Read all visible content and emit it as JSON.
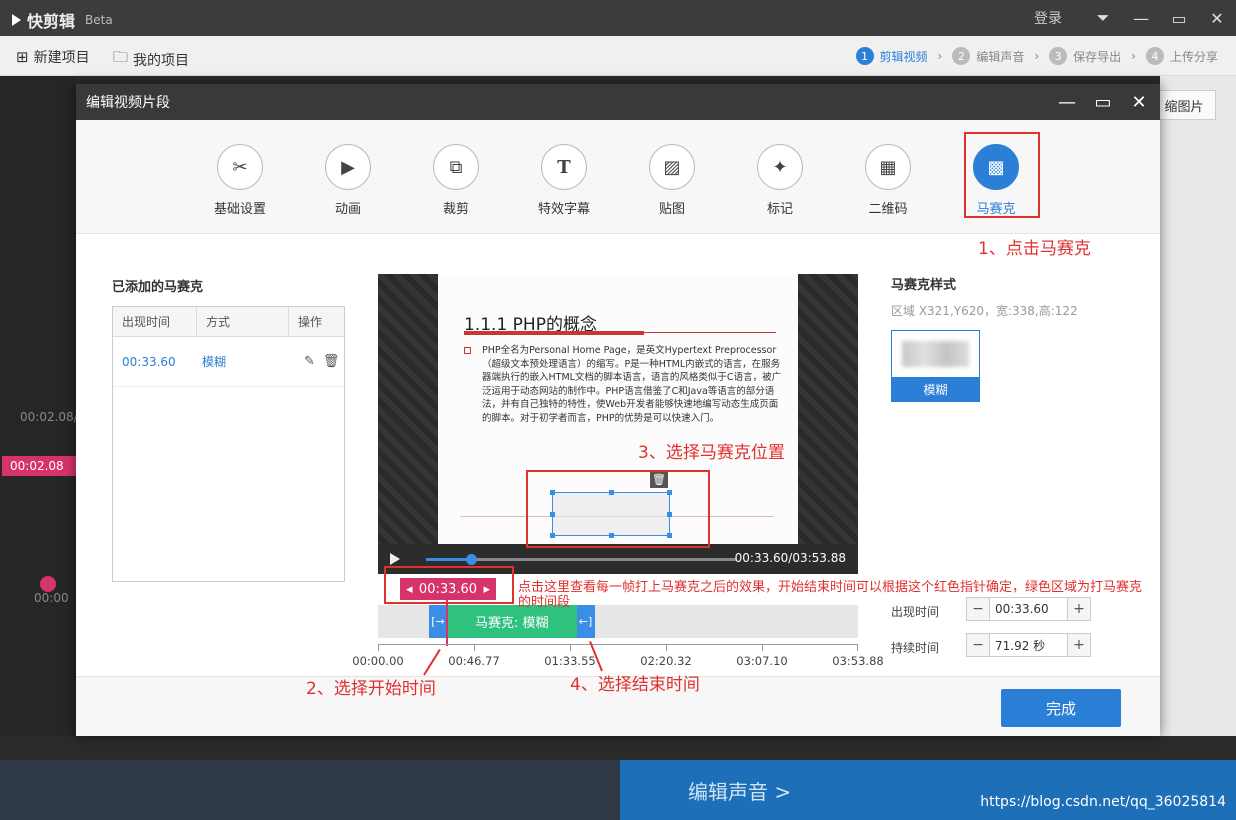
{
  "app": {
    "name": "快剪辑",
    "badge": "Beta",
    "login": "登录",
    "toolbar": {
      "new_project": "新建项目",
      "my_projects": "我的项目"
    },
    "steps": [
      {
        "num": "1",
        "label": "剪辑视频"
      },
      {
        "num": "2",
        "label": "编辑声音"
      },
      {
        "num": "3",
        "label": "保存导出"
      },
      {
        "num": "4",
        "label": "上传分享"
      }
    ],
    "right_button": "缩图片",
    "left_time": "00:02.08/0",
    "left_chip": "00:02.08",
    "left_time2": "00:00",
    "bottom_next": "编辑声音 >",
    "watermark": "https://blog.csdn.net/qq_36025814"
  },
  "dialog": {
    "title": "编辑视频片段",
    "tools": [
      {
        "label": "基础设置",
        "icon": "scissors-icon",
        "glyph": "✂"
      },
      {
        "label": "动画",
        "icon": "animation-icon",
        "glyph": "▶"
      },
      {
        "label": "裁剪",
        "icon": "crop-icon",
        "glyph": "⧉"
      },
      {
        "label": "特效字幕",
        "icon": "text-icon",
        "glyph": "T"
      },
      {
        "label": "贴图",
        "icon": "image-icon",
        "glyph": "▨"
      },
      {
        "label": "标记",
        "icon": "pin-icon",
        "glyph": "✦"
      },
      {
        "label": "二维码",
        "icon": "qrcode-icon",
        "glyph": "▦"
      },
      {
        "label": "马赛克",
        "icon": "mosaic-icon",
        "glyph": "▩"
      }
    ],
    "added": {
      "title": "已添加的马赛克",
      "headers": [
        "出现时间",
        "方式",
        "操作"
      ],
      "rows": [
        {
          "time": "00:33.60",
          "mode": "模糊"
        }
      ]
    },
    "slide": {
      "title": "1.1.1  PHP的概念",
      "body": "PHP全名为Personal Home Page，是英文Hypertext Preprocessor（超级文本预处理语言）的缩写。P是一种HTML内嵌式的语言，在服务器端执行的嵌入HTML文档的脚本语言，语言的风格类似于C语言，被广泛运用于动态网站的制作中。PHP语言借鉴了C和Java等语言的部分语法，并有自己独特的特性，使Web开发者能够快速地编写动态生成页面的脚本。对于初学者而言，PHP的优势是可以快速入门。"
    },
    "player": {
      "time": "00:33.60/03:53.88",
      "progress": 0.144
    },
    "timeline": {
      "current": "00:33.60",
      "segment_label": "马赛克: 模糊",
      "ticks": [
        "00:00.00",
        "00:46.77",
        "01:33.55",
        "02:20.32",
        "03:07.10",
        "03:53.88"
      ],
      "total_seconds": 233.88,
      "start_seconds": 33.6,
      "end_seconds": 105.52
    },
    "style_panel": {
      "title": "马赛克样式",
      "region": "区域 X321,Y620，宽:338,高:122",
      "card_label": "模糊",
      "appear_label": "出现时间",
      "appear_value": "00:33.60",
      "duration_label": "持续时间",
      "duration_value": "71.92 秒"
    },
    "done": "完成"
  },
  "annotations": {
    "a1": "1、点击马赛克",
    "a2": "2、选择开始时间",
    "a3": "3、选择马赛克位置",
    "a4": "4、选择结束时间",
    "a5": "点击这里查看每一帧打上马赛克之后的效果，开始结束时间可以根据这个红色指针确定，绿色区域为打马赛克的时间段"
  },
  "colors": {
    "accent": "#2b7fd6",
    "annotation": "#e03030",
    "segment": "#2fc17e",
    "pointer": "#d7336b"
  }
}
